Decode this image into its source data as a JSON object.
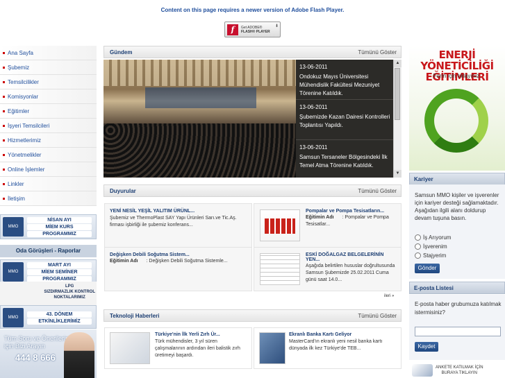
{
  "flash": {
    "message": "Content on this page requires a newer version of Adobe Flash Player.",
    "button_line1": "Get ADOBE®",
    "button_line2": "FLASH® PLAYER"
  },
  "nav": {
    "items": [
      "Ana Sayfa",
      "Şubemiz",
      "Temsilcilikler",
      "Komisyonlar",
      "Eğitimler",
      "İşyeri Temsilcileri",
      "Hizmetlerimiz",
      "Yönetmelikler",
      "Online İşlemler",
      "Linkler",
      "İletişim"
    ]
  },
  "left_banners": {
    "nisan": [
      "NİSAN AYI",
      "MİEM KURS",
      "PROGRAMMIZ"
    ],
    "oda": "Oda Görüşleri - Raporlar",
    "mart": [
      "MART AYI",
      "MİEM SEMİNER",
      "PROGRAMMIZ"
    ],
    "lpg": [
      "LPG",
      "SIZDIRMAZLIK KONTROL",
      "NOKTALARIMIZ"
    ],
    "donem": [
      "43. DÖNEM",
      "ETKİNLİKLERİMİZ"
    ],
    "support_text": [
      "Tüm Soru ve Önerileriniz",
      "için Bizi Arayın"
    ],
    "phone": "444 8 666"
  },
  "gundem": {
    "title": "Gündem",
    "show_all": "Tümünü Göster",
    "items": [
      {
        "date": "13-06-2011",
        "text": "Ondokuz Mayıs Üniversitesi Mühendislik Fakültesi Mezuniyet Törenine Katıldık."
      },
      {
        "date": "13-06-2011",
        "text": "Şubemizde Kazan Dairesi Kontrolleri Toplantısı Yapıldı."
      },
      {
        "date": "13-06-2011",
        "text": "Samsun Tersaneler Bölgesindeki İlk Temel Atma Törenine Katıldık."
      }
    ]
  },
  "duyurular": {
    "title": "Duyurular",
    "show_all": "Tümünü Göster",
    "cards": [
      {
        "title": "YENİ NESİL YEŞİL YALITIM ÜRÜNL...",
        "body": "Şubemiz ve ThermoPlast SAY Yapı Ürünleri Sarı.ve Tic.Aş. firması işbirliği ile şubemiz konferans..."
      },
      {
        "title": "Pompalar ve Pompa Tesisatların...",
        "meta_label": "Eğitimin Adı",
        "meta_value": ": Pompalar ve Pompa Tesisatlar..."
      },
      {
        "title": "Değişken Debili Soğutma Sistem...",
        "meta_label": "Eğitimin Adı",
        "meta_value": ": Değişken Debili Soğutma Sistemle..."
      },
      {
        "title": "ESKİ DOĞALGAZ BELGELERİNİN YEN...",
        "body": "Aşağıda belirtilen hususlar doğrultusunda Samsun Şubemizde 25.02.2011 Cuma günü saat 14.0..."
      }
    ],
    "more": "ileri »"
  },
  "teknoloji": {
    "title": "Teknoloji Haberleri",
    "show_all": "Tümünü Göster",
    "cards": [
      {
        "title": "Türkiye'nin İlk Yerli Zırh Ür...",
        "body": "Türk mühendisler, 3 yıl süren çalışmalarının ardından ileri balistik zırh üretimeyi başardı."
      },
      {
        "title": "Ekranlı Banka Kartı Geliyor",
        "body": "MasterCard'ın ekranlı yeni nesil banka kartı dünyada ilk kez Türkiye'de TEB..."
      }
    ]
  },
  "right": {
    "banner_title": [
      "ENERJİ YÖNETİCİLİĞİ",
      "EĞİTİMLERİ"
    ],
    "banner_sub": "Form için tıklayınız.",
    "kariyer": {
      "title": "Kariyer",
      "text": "Samsun MMO kişiler ve işverenler için kariyer desteği sağlamaktadır. Aşağıdan ilgili alanı doldurup devam tuşuna basın.",
      "options": [
        "İş Arıyorum",
        "İşverenim",
        "Stajyerim"
      ],
      "button": "Gönder"
    },
    "eposta": {
      "title": "E-posta Listesi",
      "text": "E-posta haber grubumuza katılmak istermisiniz?",
      "button": "Kaydet"
    },
    "anket": [
      "ANKETE KATILMAK İÇİN",
      "BURAYA TIKLAYIN"
    ]
  }
}
